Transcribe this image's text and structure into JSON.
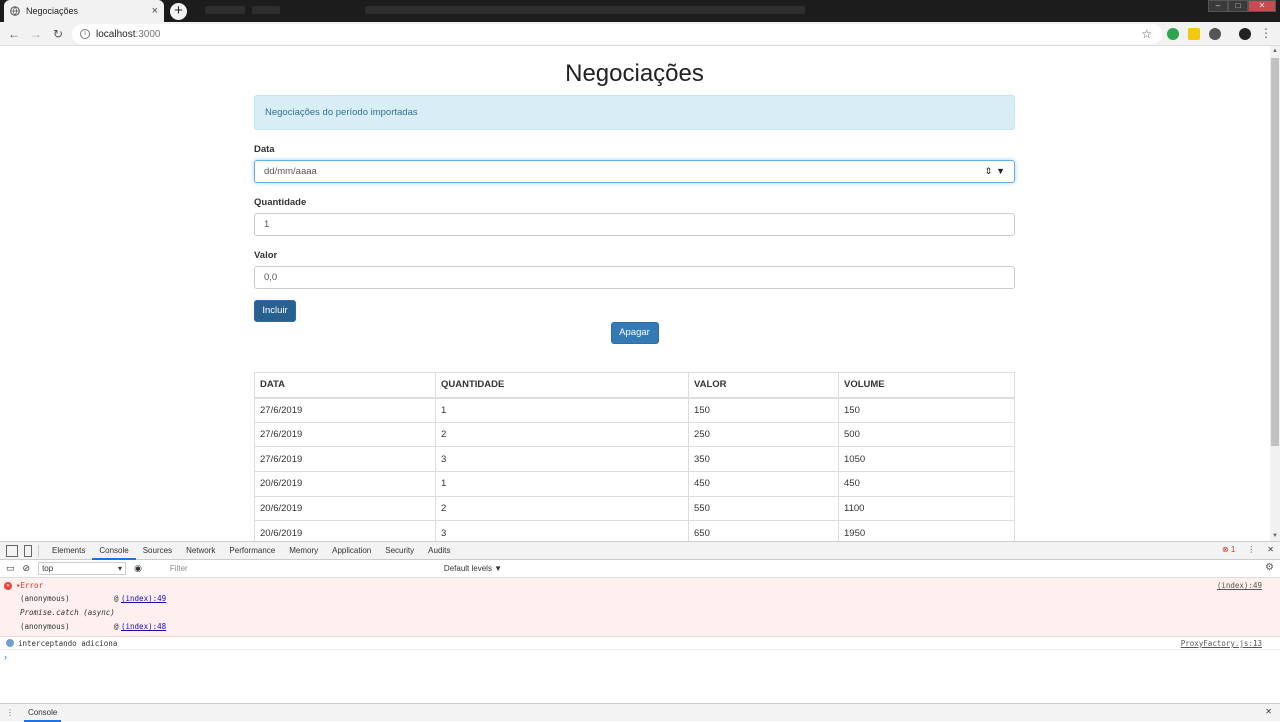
{
  "browser": {
    "tab_title": "Negociações",
    "tab_close": "×",
    "new_tab": "+",
    "url_host": "localhost",
    "url_port": ":3000",
    "back": "←",
    "forward": "→",
    "reload": "↻",
    "bookmark": "☆",
    "menu": "⋮",
    "win_min": "–",
    "win_max": "□",
    "win_close": "✕",
    "info_glyph": "i",
    "extension_colors": [
      "#2da44e",
      "#f2c811",
      "#555555",
      "#222222"
    ]
  },
  "page": {
    "title": "Negociações",
    "alert": "Negociações do período importadas",
    "form": {
      "data_label": "Data",
      "data_value": "dd/mm/aaaa",
      "data_spinner": "⇕",
      "data_dropdown": "▼",
      "quantidade_label": "Quantidade",
      "quantidade_value": "1",
      "valor_label": "Valor",
      "valor_value": "0,0",
      "incluir": "Incluir",
      "apagar": "Apagar"
    },
    "table": {
      "headers": [
        "DATA",
        "QUANTIDADE",
        "VALOR",
        "VOLUME"
      ],
      "rows": [
        [
          "27/6/2019",
          "1",
          "150",
          "150"
        ],
        [
          "27/6/2019",
          "2",
          "250",
          "500"
        ],
        [
          "27/6/2019",
          "3",
          "350",
          "1050"
        ],
        [
          "20/6/2019",
          "1",
          "450",
          "450"
        ],
        [
          "20/6/2019",
          "2",
          "550",
          "1100"
        ],
        [
          "20/6/2019",
          "3",
          "650",
          "1950"
        ]
      ]
    }
  },
  "devtools": {
    "tabs": [
      "Elements",
      "Console",
      "Sources",
      "Network",
      "Performance",
      "Memory",
      "Application",
      "Security",
      "Audits"
    ],
    "active_tab": "Console",
    "error_count": "1",
    "context": "top",
    "filter_placeholder": "Filter",
    "levels": "Default levels ▼",
    "error": {
      "title": "▾Error",
      "source": "(index):49",
      "stack": [
        {
          "fn": "(anonymous)",
          "at": "@",
          "link": "(index):49"
        },
        {
          "fn": "Promise.catch (async)",
          "at": "",
          "link": ""
        },
        {
          "fn": "(anonymous)",
          "at": "@",
          "link": "(index):48"
        }
      ]
    },
    "info": {
      "text": "interceptando adiciona",
      "source": "ProxyFactory.js:13"
    },
    "prompt": "›",
    "drawer_tab": "Console",
    "close": "✕",
    "kebab": "⋮",
    "gear": "⚙",
    "eye": "👁"
  }
}
